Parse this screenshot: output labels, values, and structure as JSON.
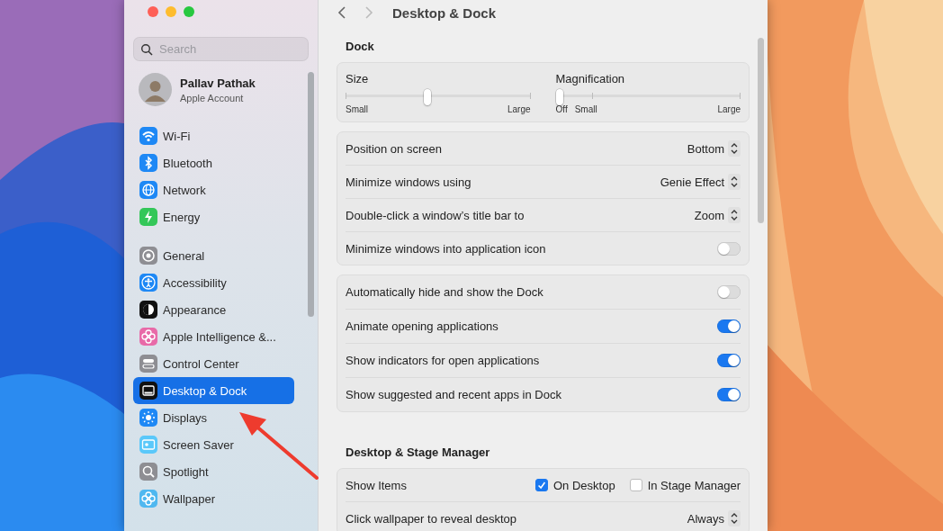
{
  "sidebar": {
    "search": {
      "placeholder": "Search"
    },
    "account": {
      "name": "Pallav Pathak",
      "subtitle": "Apple Account"
    },
    "groups": [
      {
        "items": [
          {
            "label": "Wi-Fi",
            "kind": "wifi",
            "color": "#1e88f5",
            "selected": false
          },
          {
            "label": "Bluetooth",
            "kind": "bluetooth",
            "color": "#1e88f5",
            "selected": false
          },
          {
            "label": "Network",
            "kind": "globe",
            "color": "#1e88f5",
            "selected": false
          },
          {
            "label": "Energy",
            "kind": "bolt",
            "color": "#34c759",
            "selected": false
          }
        ]
      },
      {
        "items": [
          {
            "label": "General",
            "kind": "gear",
            "color": "#8e8e93",
            "selected": false
          },
          {
            "label": "Accessibility",
            "kind": "person",
            "color": "#1e88f5",
            "selected": false
          },
          {
            "label": "Appearance",
            "kind": "halfcircle",
            "color": "#111111",
            "selected": false
          },
          {
            "label": "Apple Intelligence &...",
            "kind": "flower",
            "color": "#e86aa8",
            "selected": false
          },
          {
            "label": "Control Center",
            "kind": "switches",
            "color": "#8e8e93",
            "selected": false
          },
          {
            "label": "Desktop & Dock",
            "kind": "dock",
            "color": "#111111",
            "selected": true
          },
          {
            "label": "Displays",
            "kind": "sun",
            "color": "#1e88f5",
            "selected": false
          },
          {
            "label": "Screen Saver",
            "kind": "screen",
            "color": "#5ac8fa",
            "selected": false
          },
          {
            "label": "Spotlight",
            "kind": "search",
            "color": "#8e8e93",
            "selected": false
          },
          {
            "label": "Wallpaper",
            "kind": "flower",
            "color": "#4fb8f0",
            "selected": false
          }
        ]
      }
    ]
  },
  "content": {
    "title": "Desktop & Dock",
    "sections": [
      {
        "heading": "Dock",
        "cards": [
          {
            "rows": [
              {
                "kind": "sliders",
                "sliders": [
                  {
                    "label": "Size",
                    "level": 0.44,
                    "min_label": "Small",
                    "max_label": "Large"
                  },
                  {
                    "label": "Magnification",
                    "level": 0,
                    "off_label": "Off",
                    "min_label": "Small",
                    "max_label": "Large"
                  }
                ]
              }
            ]
          },
          {
            "rows": [
              {
                "kind": "popup",
                "label": "Position on screen",
                "value": "Bottom"
              },
              {
                "kind": "popup",
                "label": "Minimize windows using",
                "value": "Genie Effect"
              },
              {
                "kind": "popup",
                "label": "Double-click a window’s title bar to",
                "value": "Zoom"
              },
              {
                "kind": "toggle",
                "label": "Minimize windows into application icon",
                "on": false
              }
            ]
          },
          {
            "rows": [
              {
                "kind": "toggle",
                "label": "Automatically hide and show the Dock",
                "on": false
              },
              {
                "kind": "toggle",
                "label": "Animate opening applications",
                "on": true
              },
              {
                "kind": "toggle",
                "label": "Show indicators for open applications",
                "on": true
              },
              {
                "kind": "toggle",
                "label": "Show suggested and recent apps in Dock",
                "on": true
              }
            ]
          }
        ]
      },
      {
        "heading": "Desktop & Stage Manager",
        "cards": [
          {
            "rows": [
              {
                "kind": "checks",
                "label": "Show Items",
                "options": [
                  {
                    "label": "On Desktop",
                    "checked": true
                  },
                  {
                    "label": "In Stage Manager",
                    "checked": false
                  }
                ]
              },
              {
                "kind": "popup",
                "label": "Click wallpaper to reveal desktop",
                "value": "Always"
              }
            ]
          }
        ]
      }
    ]
  }
}
